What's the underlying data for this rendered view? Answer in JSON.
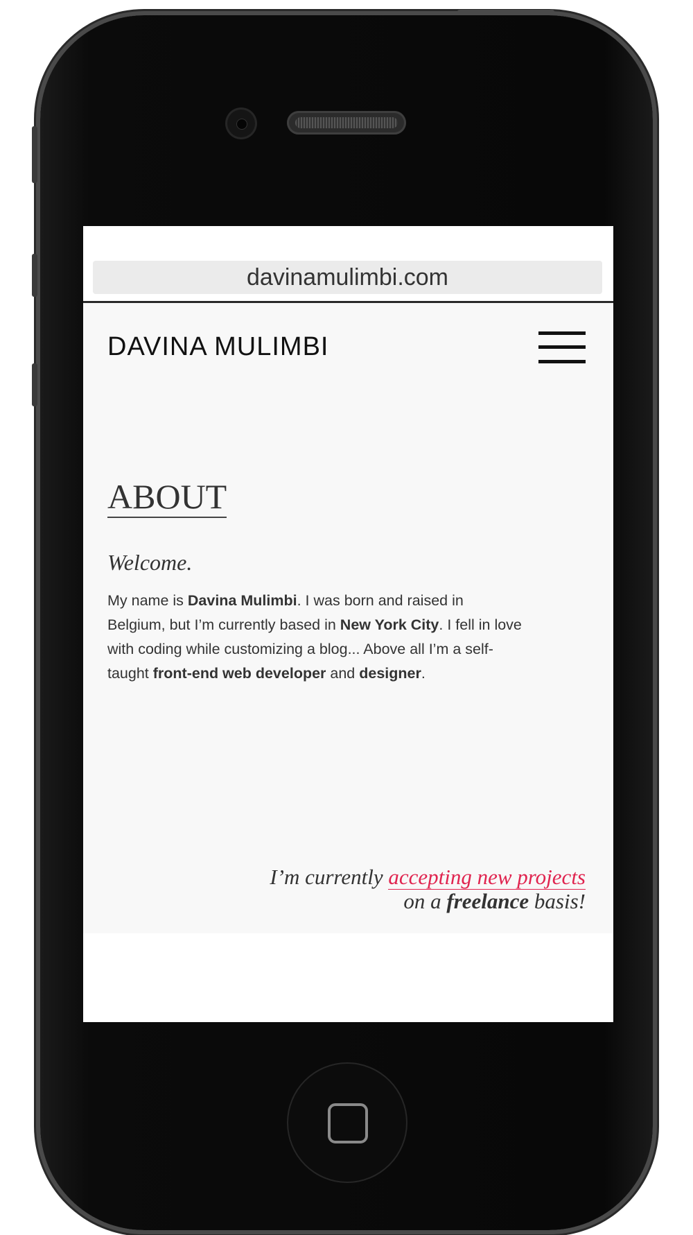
{
  "browser": {
    "url": "davinamulimbi.com"
  },
  "header": {
    "brand": "DAVINA MULIMBI"
  },
  "about": {
    "heading": "ABOUT",
    "welcome": "Welcome.",
    "bio": {
      "intro": "My name is ",
      "name": "Davina Mulimbi",
      "born": ". I was born and raised in Belgium, but I’m currently based in ",
      "city": "New York City",
      "love": ". I fell in love with coding while customizing a blog... Above all I’m a self-taught ",
      "role": "front-end web developer",
      "and": " and ",
      "role2": "designer",
      "end": "."
    }
  },
  "freelance": {
    "prefix": "I’m currently ",
    "link": "accepting new projects",
    "line2_prefix": "on a ",
    "emphasis": "freelance",
    "line2_suffix": " basis!",
    "link_color": "#e0244f"
  }
}
